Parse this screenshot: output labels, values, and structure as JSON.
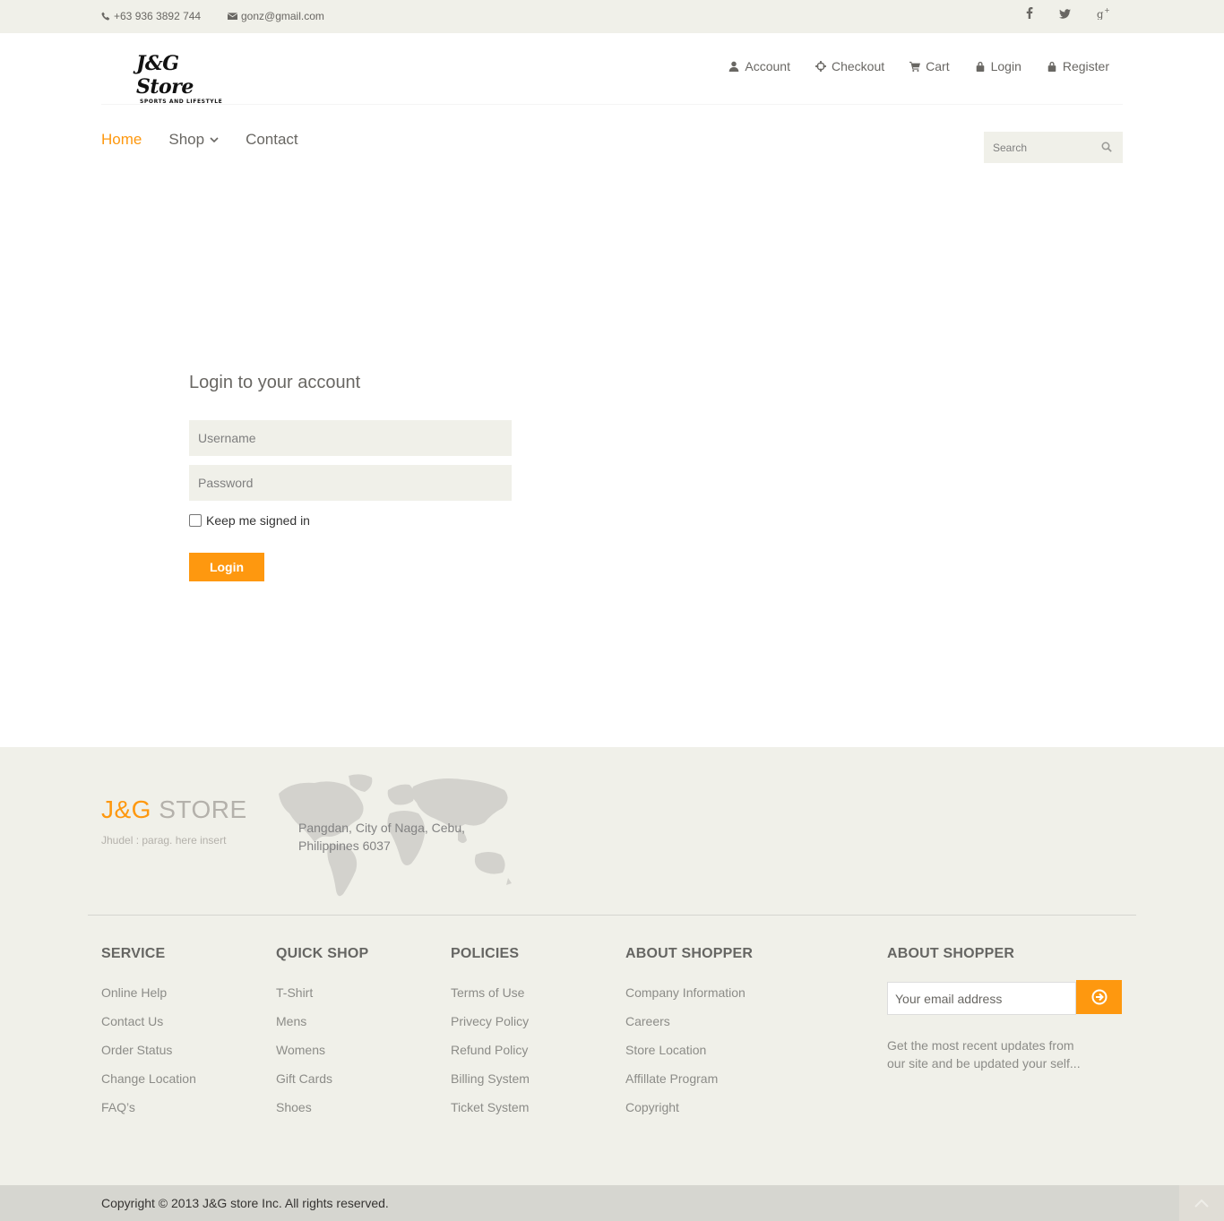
{
  "topbar": {
    "phone": "+63 936 3892 744",
    "email": "gonz@gmail.com",
    "social": [
      "facebook-icon",
      "twitter-icon",
      "google-plus-icon"
    ]
  },
  "header": {
    "logo_script": "J&G Store",
    "logo_tagline": "SPORTS AND LIFESTYLE",
    "usermenu": {
      "account": "Account",
      "checkout": "Checkout",
      "cart": "Cart",
      "login": "Login",
      "register": "Register"
    }
  },
  "nav": {
    "home": "Home",
    "shop": "Shop",
    "contact": "Contact",
    "search_placeholder": "Search"
  },
  "login": {
    "title": "Login to your account",
    "username_placeholder": "Username",
    "password_placeholder": "Password",
    "keep_signed_in": "Keep me signed in",
    "button": "Login"
  },
  "footer": {
    "brand_a": "J&G",
    "brand_b": " STORE",
    "brand_sub": "Jhudel : parag. here insert",
    "address_line1": "Pangdan, City of Naga, Cebu,",
    "address_line2": "Philippines 6037",
    "columns": {
      "service": {
        "title": "SERVICE",
        "items": [
          "Online Help",
          "Contact Us",
          "Order Status",
          "Change Location",
          "FAQ’s"
        ]
      },
      "quickshop": {
        "title": "QUICK SHOP",
        "items": [
          "T-Shirt",
          "Mens",
          "Womens",
          "Gift Cards",
          "Shoes"
        ]
      },
      "policies": {
        "title": "POLICIES",
        "items": [
          "Terms of Use",
          "Privecy Policy",
          "Refund Policy",
          "Billing System",
          "Ticket System"
        ]
      },
      "about": {
        "title": "ABOUT SHOPPER",
        "items": [
          "Company Information",
          "Careers",
          "Store Location",
          "Affillate Program",
          "Copyright"
        ]
      }
    },
    "subscribe": {
      "title": "ABOUT SHOPPER",
      "email_placeholder": "Your email address",
      "text": "Get the most recent updates from our site and be updated your self..."
    },
    "copyright": "Copyright © 2013 J&G store Inc. All rights reserved."
  },
  "colors": {
    "accent": "#fe980f",
    "panel": "#f0f0e9",
    "bottom": "#d6d6d0"
  }
}
